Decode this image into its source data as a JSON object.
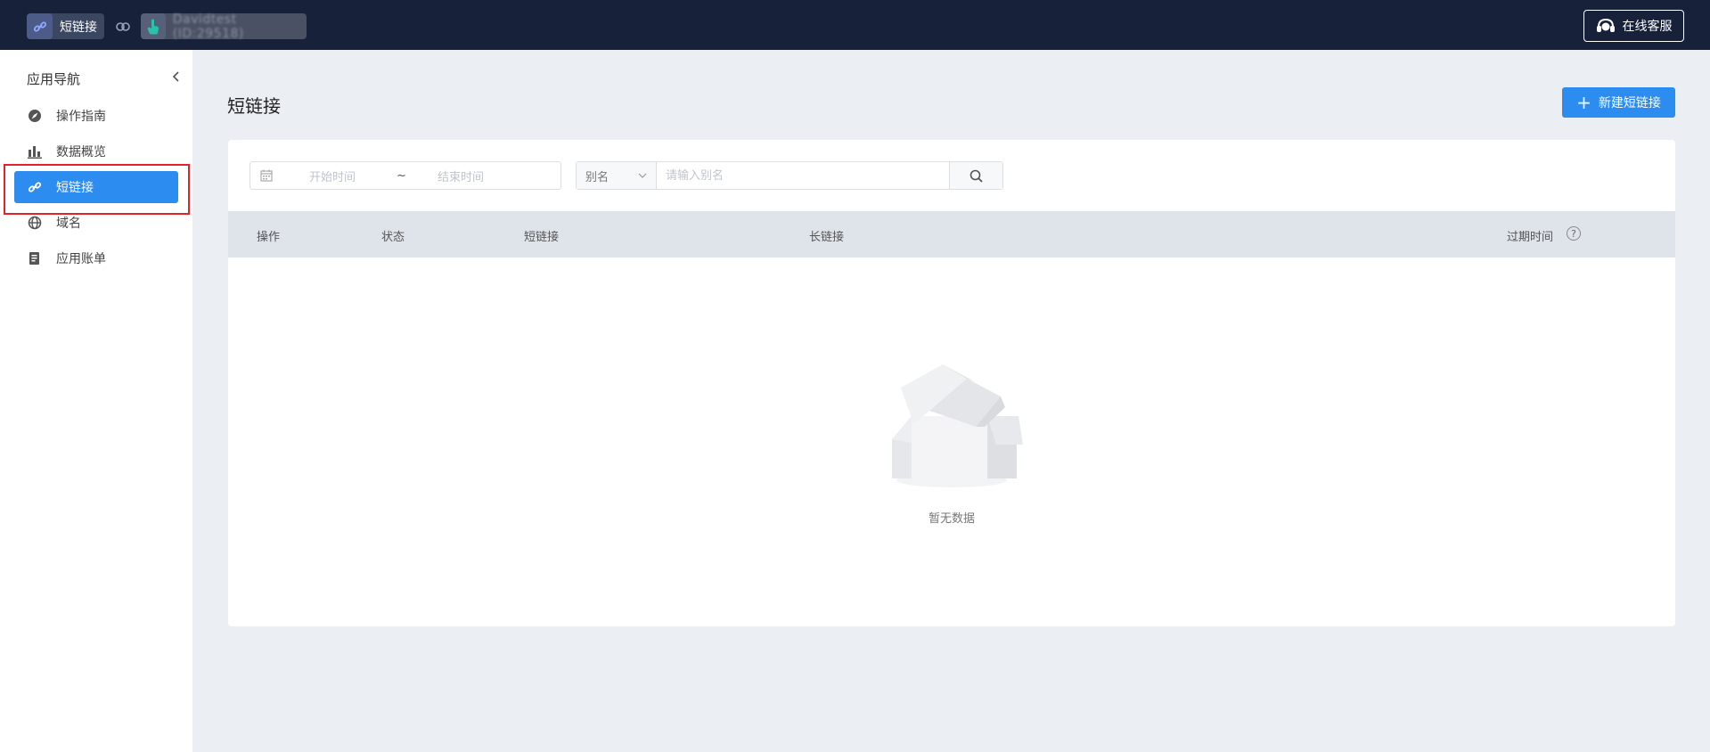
{
  "topbar": {
    "app_label": "短链接",
    "account_label": "Davidtest (ID:29518)",
    "support_label": "在线客服"
  },
  "sidebar": {
    "title": "应用导航",
    "items": [
      {
        "label": "操作指南",
        "icon": "navigation-icon"
      },
      {
        "label": "数据概览",
        "icon": "bar-chart-icon"
      },
      {
        "label": "短链接",
        "icon": "link-icon",
        "active": true
      },
      {
        "label": "域名",
        "icon": "globe-icon"
      },
      {
        "label": "应用账单",
        "icon": "document-icon"
      }
    ]
  },
  "main": {
    "title": "短链接",
    "new_button_label": "新建短链接",
    "filter": {
      "start_placeholder": "开始时间",
      "separator": "~",
      "end_placeholder": "结束时间",
      "select_value": "别名",
      "search_placeholder": "请输入别名"
    },
    "table": {
      "columns": [
        "操作",
        "状态",
        "短链接",
        "长链接",
        "过期时间"
      ],
      "rows": []
    },
    "empty_text": "暂无数据"
  },
  "colors": {
    "topbar_bg": "#17213a",
    "accent": "#2d8cf0",
    "highlight": "#e4222a",
    "page_bg": "#ebeef2"
  }
}
